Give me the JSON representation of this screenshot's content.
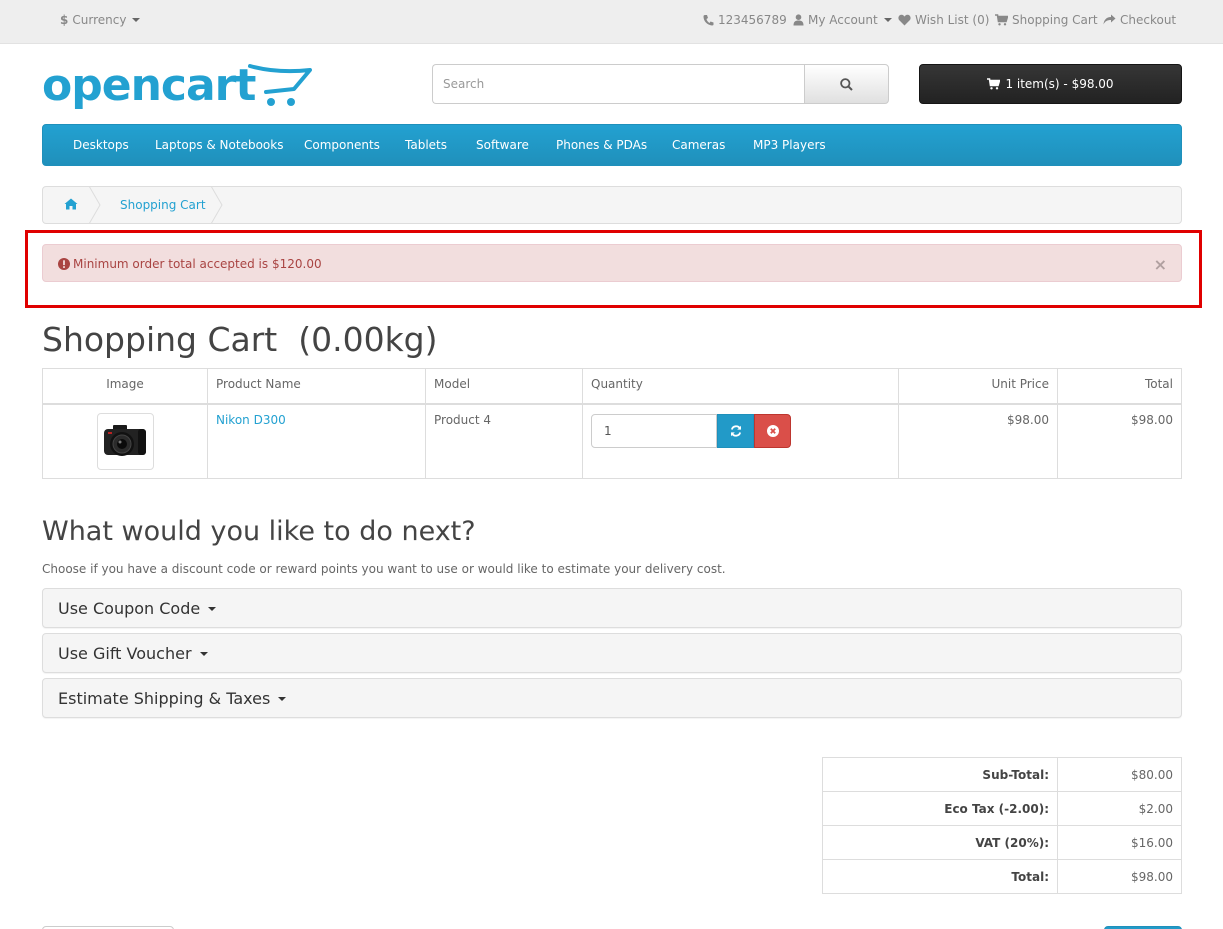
{
  "topbar": {
    "currency_symbol": "$",
    "currency_label": "Currency",
    "phone": "123456789",
    "my_account": "My Account",
    "wish_list": "Wish List (0)",
    "shopping_cart": "Shopping Cart",
    "checkout": "Checkout"
  },
  "header": {
    "logo_text": "opencart",
    "search_placeholder": "Search",
    "cart_button": "1 item(s) - $98.00"
  },
  "menu": [
    "Desktops",
    "Laptops & Notebooks",
    "Components",
    "Tablets",
    "Software",
    "Phones & PDAs",
    "Cameras",
    "MP3 Players"
  ],
  "breadcrumb": {
    "current": "Shopping Cart"
  },
  "alert": {
    "message": "Minimum order total accepted is $120.00",
    "close": "×"
  },
  "page_title": "Shopping Cart  (0.00kg)",
  "cart_table": {
    "headers": [
      "Image",
      "Product Name",
      "Model",
      "Quantity",
      "Unit Price",
      "Total"
    ],
    "rows": [
      {
        "name": "Nikon D300",
        "model": "Product 4",
        "quantity": "1",
        "unit_price": "$98.00",
        "total": "$98.00"
      }
    ]
  },
  "next": {
    "title": "What would you like to do next?",
    "description": "Choose if you have a discount code or reward points you want to use or would like to estimate your delivery cost.",
    "panels": [
      "Use Coupon Code",
      "Use Gift Voucher",
      "Estimate Shipping & Taxes"
    ]
  },
  "totals": [
    {
      "label": "Sub-Total:",
      "value": "$80.00"
    },
    {
      "label": "Eco Tax (-2.00):",
      "value": "$2.00"
    },
    {
      "label": "VAT (20%):",
      "value": "$16.00"
    },
    {
      "label": "Total:",
      "value": "$98.00"
    }
  ],
  "colors": {
    "brand_blue": "#23a1d1",
    "alert_bg": "#f2dede",
    "alert_text": "#a94442",
    "highlight_red": "#e00000"
  }
}
